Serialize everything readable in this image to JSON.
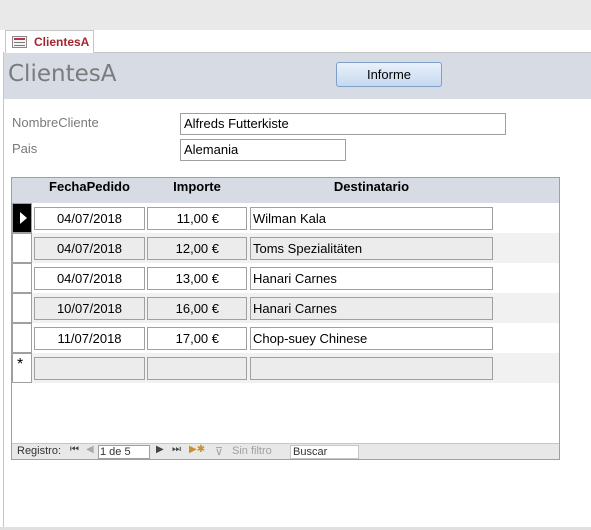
{
  "tab": {
    "label": "ClientesA"
  },
  "form": {
    "title": "ClientesA",
    "report_button": "Informe"
  },
  "fields": {
    "nombre_cliente": {
      "label": "NombreCliente",
      "value": "Alfreds Futterkiste"
    },
    "pais": {
      "label": "Pais",
      "value": "Alemania"
    }
  },
  "subform": {
    "columns": [
      "FechaPedido",
      "Importe",
      "Destinatario"
    ],
    "rows": [
      {
        "fecha": "04/07/2018",
        "importe": "11,00 €",
        "destinatario": "Wilman Kala"
      },
      {
        "fecha": "04/07/2018",
        "importe": "12,00 €",
        "destinatario": "Toms Spezialitäten"
      },
      {
        "fecha": "04/07/2018",
        "importe": "13,00 €",
        "destinatario": "Hanari Carnes"
      },
      {
        "fecha": "10/07/2018",
        "importe": "16,00 €",
        "destinatario": "Hanari Carnes"
      },
      {
        "fecha": "11/07/2018",
        "importe": "17,00 €",
        "destinatario": "Chop-suey Chinese"
      }
    ],
    "new_record_marker": "*"
  },
  "navigation": {
    "label": "Registro:",
    "current": "1 de 5",
    "filter": "Sin filtro",
    "search": "Buscar"
  },
  "colors": {
    "header_bg": "#d6dbe4",
    "tab_text": "#a4262c",
    "current_record": "#000000"
  }
}
